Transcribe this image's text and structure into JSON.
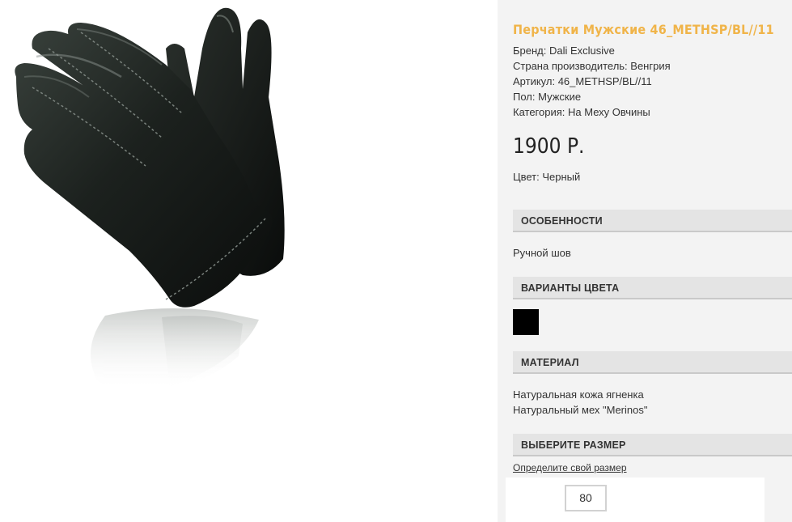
{
  "product": {
    "title": "Перчатки Мужские 46_METHSP/BL//11",
    "specs": [
      "Бренд: Dali Exclusive",
      "Страна производитель: Венгрия",
      "Артикул: 46_METHSP/BL//11",
      "Пол: Мужские",
      "Категория: На Меху Овчины"
    ],
    "price": "1900 Р.",
    "color_line": "Цвет: Черный"
  },
  "sections": {
    "features": {
      "heading": "ОСОБЕННОСТИ",
      "text": "Ручной шов"
    },
    "color_variants": {
      "heading": "ВАРИАНТЫ ЦВЕТА",
      "swatch_color": "#000000"
    },
    "material": {
      "heading": "МАТЕРИАЛ",
      "lines": [
        "Натуральная кожа ягненка",
        "Натуральный мех \"Merinos\""
      ]
    },
    "size": {
      "heading": "ВЫБЕРИТЕ РАЗМЕР",
      "link": "Определите свой размер",
      "options": [
        "80"
      ]
    }
  },
  "colors": {
    "title_accent": "#f0b449",
    "panel_bg": "#f3f3f3",
    "section_bg": "#e4e4e4"
  }
}
